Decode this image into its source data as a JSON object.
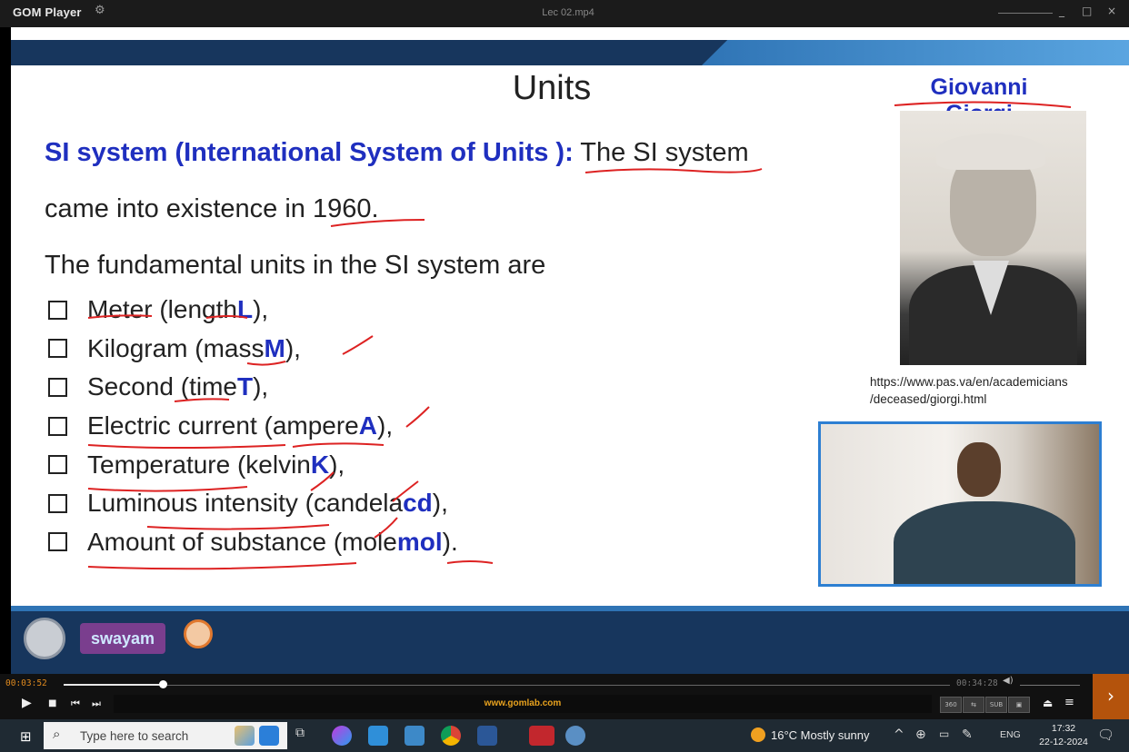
{
  "window": {
    "app_name": "GOM Player",
    "file_title": "Lec 02.mp4",
    "controls": {
      "minimize": "_",
      "maximize": "□",
      "close": "×"
    }
  },
  "slide": {
    "title": "Units",
    "si_heading": "SI system (International System of Units ):",
    "si_text": "The SI system",
    "line_1960": "came into existence in 1960.",
    "fundamental_intro": "The fundamental units in the SI system are",
    "units": [
      {
        "text": "Meter (length ",
        "symbol": "L",
        "suffix": "),"
      },
      {
        "text": "Kilogram (mass ",
        "symbol": "M",
        "suffix": "),"
      },
      {
        "text": "Second (time ",
        "symbol": "T",
        "suffix": "),"
      },
      {
        "text": "Electric current (ampere ",
        "symbol": "A",
        "suffix": "),"
      },
      {
        "text": "Temperature  (kelvin ",
        "symbol": "K",
        "suffix": "),"
      },
      {
        "text": "Luminous intensity (candela ",
        "symbol": "cd",
        "suffix": "),"
      },
      {
        "text": "Amount of substance (mole ",
        "symbol": "mol",
        "suffix": ")."
      }
    ],
    "person_name": "Giovanni Giorgi",
    "portrait_credit_line1": "https://www.pas.va/en/academicians",
    "portrait_credit_line2": "/deceased/giorgi.html",
    "logo_swayam": "swayam"
  },
  "player": {
    "time_elapsed": "00:03:52",
    "time_total": "00:34:28",
    "progress": 0.1123,
    "url_text": "www.gomlab.com",
    "buttons": {
      "play": "▶",
      "stop": "■",
      "prev": "⏮",
      "next": "⏭",
      "eject": "⏏",
      "menu": "≡",
      "sub": "SUB",
      "side_next": "›"
    }
  },
  "taskbar": {
    "search_placeholder": "Type here to search",
    "weather": "16°C  Mostly sunny",
    "lang": "ENG",
    "time": "17:32",
    "date": "22-12-2024"
  },
  "colors": {
    "slide_band": "#17365d",
    "slide_accent": "#2f74b5",
    "si_blue": "#1f2fbf",
    "elapsed_orange": "#e08a1e"
  }
}
